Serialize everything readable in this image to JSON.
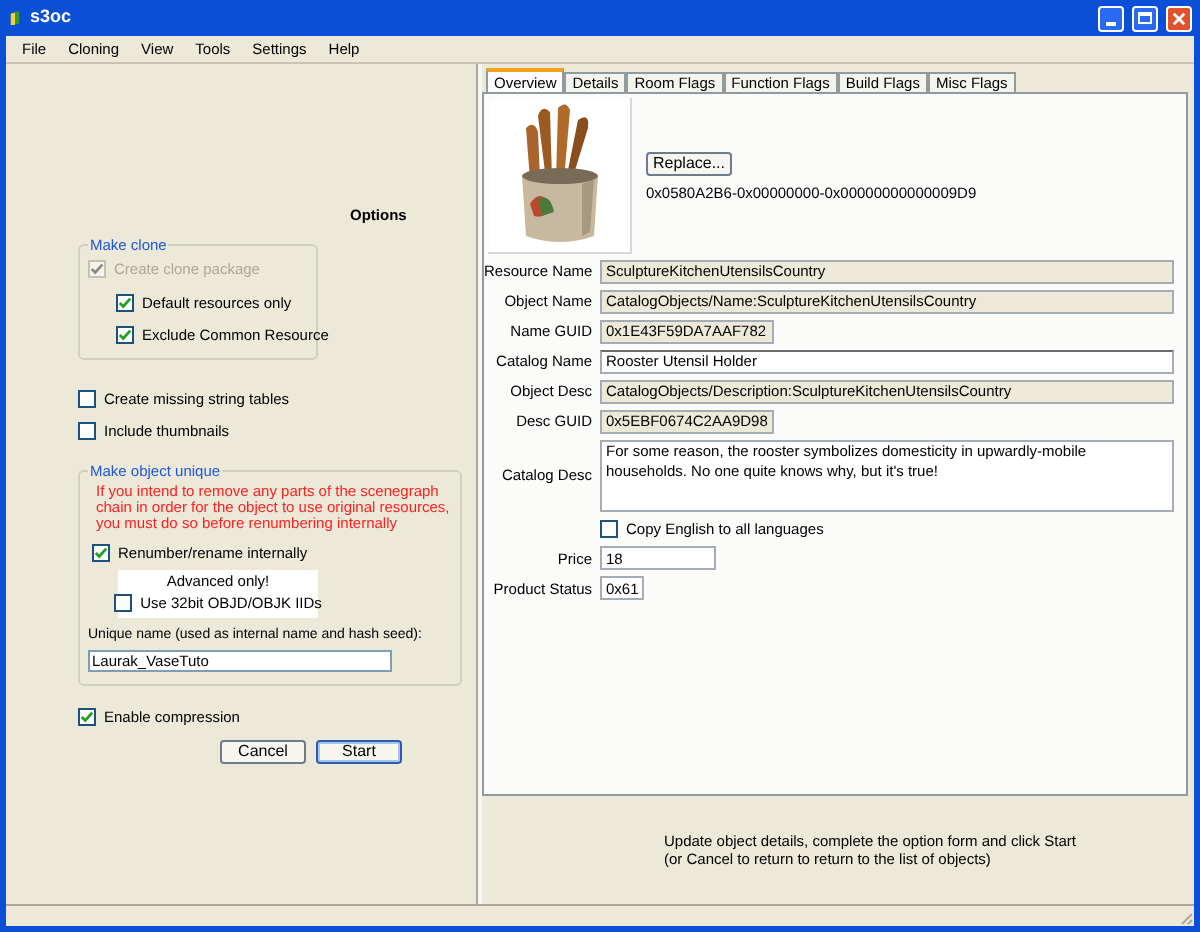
{
  "window": {
    "title": "s3oc"
  },
  "menu": [
    "File",
    "Cloning",
    "View",
    "Tools",
    "Settings",
    "Help"
  ],
  "options": {
    "title": "Options",
    "make_clone": {
      "title": "Make clone",
      "items": [
        {
          "label": "Create clone package",
          "checked": true,
          "disabled": true,
          "indented": false
        },
        {
          "label": "Default resources only",
          "checked": true,
          "disabled": false,
          "indented": true
        },
        {
          "label": "Exclude Common Resource",
          "checked": true,
          "disabled": false,
          "indented": true
        }
      ]
    },
    "extra": [
      {
        "label": "Create missing string tables",
        "checked": false
      },
      {
        "label": "Include thumbnails",
        "checked": false
      }
    ],
    "make_unique": {
      "title": "Make object unique",
      "warning": "If you intend to remove any parts of the scenegraph chain in order for the object to use original resources, you must do so before renumbering internally",
      "renumber": {
        "label": "Renumber/rename internally",
        "checked": true
      },
      "advanced": {
        "title": "Advanced only!",
        "label": "Use 32bit OBJD/OBJK IIDs",
        "checked": false
      },
      "unique_name": {
        "label": "Unique name (used as internal name and hash seed):",
        "value": "Laurak_VaseTuto"
      }
    },
    "compression": {
      "label": "Enable compression",
      "checked": true
    },
    "buttons": [
      {
        "label": "Cancel",
        "default": false
      },
      {
        "label": "Start",
        "default": true
      }
    ]
  },
  "tabs": [
    {
      "label": "Overview",
      "selected": true
    },
    {
      "label": "Details",
      "selected": false
    },
    {
      "label": "Room Flags",
      "selected": false
    },
    {
      "label": "Function Flags",
      "selected": false
    },
    {
      "label": "Build Flags",
      "selected": false
    },
    {
      "label": "Misc Flags",
      "selected": false
    }
  ],
  "thumbnail": {
    "kind": "picture",
    "button": "Replace...",
    "key": "0x0580A2B6-0x00000000-0x00000000000009D9"
  },
  "fields": [
    {
      "kind": "name",
      "label": "Resource Name",
      "value": "SculptureKitchenUtensilsCountry"
    },
    {
      "kind": "name",
      "label": "Object Name",
      "value": "CatalogObjects/Name:SculptureKitchenUtensilsCountry"
    },
    {
      "kind": "guid",
      "label": "Name GUID",
      "value": "0x1E43F59DA7AAF782"
    },
    {
      "kind": "text",
      "label": "Catalog Name",
      "value": "Rooster Utensil Holder"
    },
    {
      "kind": "name",
      "label": "Object Desc",
      "value": "CatalogObjects/Description:SculptureKitchenUtensilsCountry"
    },
    {
      "kind": "guid",
      "label": "Desc GUID",
      "value": "0x5EBF0674C2AA9D98"
    },
    {
      "kind": "memo",
      "label": "Catalog Desc",
      "value": "For some reason, the rooster symbolizes domesticity in upwardly-mobile households. No one quite knows why, but it's true!"
    },
    {
      "kind": "check",
      "label": "Copy English to all languages",
      "checked": false
    },
    {
      "kind": "number",
      "label": "Price",
      "value": "18"
    },
    {
      "kind": "code",
      "label": "Product Status",
      "value": "0x61"
    }
  ],
  "message": [
    "Update object details, complete the option form and click Start",
    "(or Cancel to return to return to the list of objects)"
  ]
}
